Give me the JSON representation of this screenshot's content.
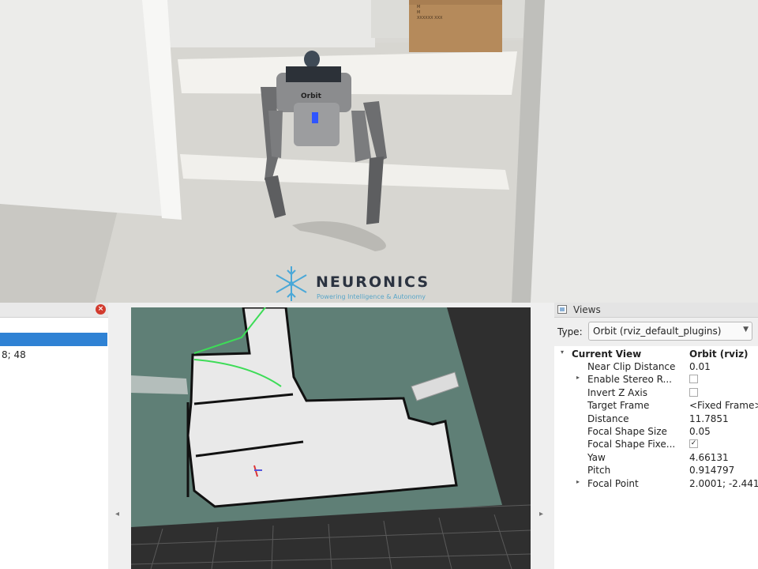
{
  "camera": {
    "box_label_lines": [
      "M",
      "M",
      "XXXXXX XXX"
    ],
    "robot_label": "Orbit"
  },
  "brand": {
    "name": "NEURONICS",
    "tagline": "Powering Intelligence & Autonomy"
  },
  "left_panel": {
    "close_icon": "close-icon",
    "selected_row_text": "",
    "value_text": "8; 48"
  },
  "views_panel": {
    "title": "Views",
    "type_label": "Type:",
    "type_value": "Orbit (rviz_default_plugins)",
    "current_view": {
      "name": "Current View",
      "value": "Orbit (rviz)"
    },
    "properties": [
      {
        "name": "Near Clip Distance",
        "value": "0.01",
        "kind": "text",
        "expander": ""
      },
      {
        "name": "Enable Stereo R...",
        "value": "",
        "kind": "checkbox",
        "checked": false,
        "expander": "▸"
      },
      {
        "name": "Invert Z Axis",
        "value": "",
        "kind": "checkbox",
        "checked": false,
        "expander": ""
      },
      {
        "name": "Target Frame",
        "value": "<Fixed Frame>",
        "kind": "text",
        "expander": ""
      },
      {
        "name": "Distance",
        "value": "11.7851",
        "kind": "text",
        "expander": ""
      },
      {
        "name": "Focal Shape Size",
        "value": "0.05",
        "kind": "text",
        "expander": ""
      },
      {
        "name": "Focal Shape Fixe...",
        "value": "",
        "kind": "checkbox",
        "checked": true,
        "expander": ""
      },
      {
        "name": "Yaw",
        "value": "4.66131",
        "kind": "text",
        "expander": ""
      },
      {
        "name": "Pitch",
        "value": "0.914797",
        "kind": "text",
        "expander": ""
      },
      {
        "name": "Focal Point",
        "value": "2.0001; -2.441",
        "kind": "text",
        "expander": "▸"
      }
    ]
  },
  "colors": {
    "selection": "#2f82d4",
    "map_free": "#e9e9e9",
    "map_unknown": "#5f7f76",
    "view_background": "#2f2f2f",
    "path": "#3ddc57"
  }
}
